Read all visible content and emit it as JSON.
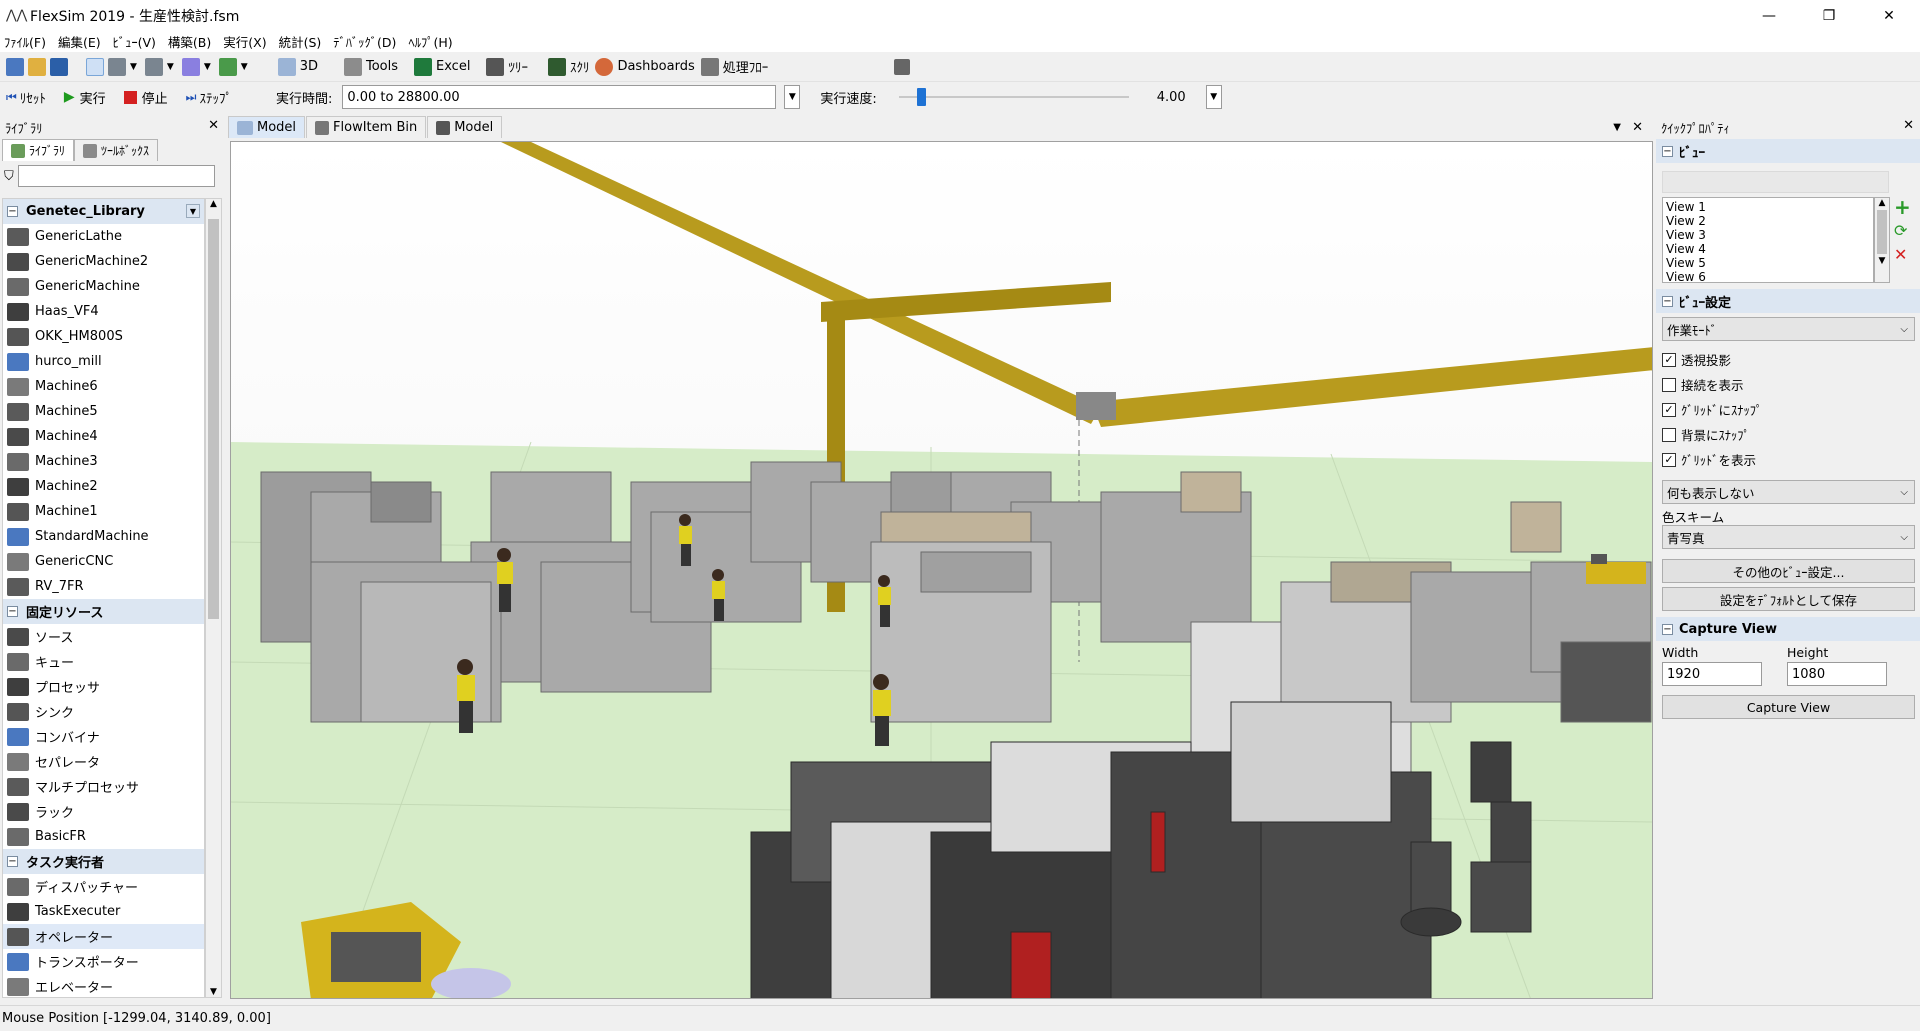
{
  "window": {
    "title": "FlexSim 2019 - 生産性検討.fsm",
    "minimize": "—",
    "maximize": "❐",
    "close": "✕"
  },
  "menu": [
    "ﾌｧｲﾙ(F)",
    "編集(E)",
    "ﾋﾞｭｰ(V)",
    "構築(B)",
    "実行(X)",
    "統計(S)",
    "ﾃﾞﾊﾞｯｸﾞ(D)",
    "ﾍﾙﾌﾟ(H)"
  ],
  "toolbar": {
    "btn_3d": "3D",
    "btn_tools": "Tools",
    "btn_excel": "Excel",
    "btn_tree": "ﾂﾘｰ",
    "btn_script": "ｽｸﾘ",
    "btn_dashboards": "Dashboards",
    "btn_processflow": "処理ﾌﾛｰ"
  },
  "runbar": {
    "reset": "ﾘｾｯﾄ",
    "run": "実行",
    "stop": "停止",
    "step": "ｽﾃｯﾌﾟ",
    "runtime_label": "実行時間:",
    "runtime_value": "0.00  to  28800.00",
    "speed_label": "実行速度:",
    "speed_value": "4.00",
    "speed_fraction": 0.08
  },
  "library": {
    "panel_title": "ﾗｲﾌﾞﾗﾘ",
    "tab_library": "ﾗｲﾌﾞﾗﾘ",
    "tab_toolbox": "ﾂｰﾙﾎﾞｯｸｽ",
    "groups": [
      {
        "name": "Genetec_Library",
        "items": [
          "GenericLathe",
          "GenericMachine2",
          "GenericMachine",
          "Haas_VF4",
          "OKK_HM800S",
          "hurco_mill",
          "Machine6",
          "Machine5",
          "Machine4",
          "Machine3",
          "Machine2",
          "Machine1",
          "StandardMachine",
          "GenericCNC",
          "RV_7FR"
        ]
      },
      {
        "name": "固定リソース",
        "items": [
          "ソース",
          "キュー",
          "プロセッサ",
          "シンク",
          "コンバイナ",
          "セパレータ",
          "マルチプロセッサ",
          "ラック",
          "BasicFR"
        ]
      },
      {
        "name": "タスク実行者",
        "items": [
          "ディスパッチャー",
          "TaskExecuter",
          "オペレーター",
          "トランスポーター",
          "エレベーター"
        ]
      }
    ],
    "selected_item": "オペレーター"
  },
  "view_tabs": [
    "Model",
    "FlowItem Bin",
    "Model"
  ],
  "quick_props": {
    "panel_title": "ｸｲｯｸﾌﾟﾛﾊﾟﾃｨ",
    "sec_view": "ﾋﾞｭｰ",
    "views": [
      "View 1",
      "View 2",
      "View 3",
      "View 4",
      "View 5",
      "View 6"
    ],
    "sec_view_settings": "ﾋﾞｭｰ設定",
    "mode": "作業ﾓｰﾄﾞ",
    "checks": [
      {
        "label": "透視投影",
        "checked": true
      },
      {
        "label": "接続を表示",
        "checked": false
      },
      {
        "label": "ｸﾞﾘｯﾄﾞにｽﾅｯﾌﾟ",
        "checked": true
      },
      {
        "label": "背景にｽﾅｯﾌﾟ",
        "checked": false
      },
      {
        "label": "ｸﾞﾘｯﾄﾞを表示",
        "checked": true
      }
    ],
    "display": "何も表示しない",
    "color_scheme_label": "色スキーム",
    "color_scheme": "青写真",
    "btn_more": "その他のﾋﾞｭｰ設定...",
    "btn_save_default": "設定をﾃﾞﾌｫﾙﾄとして保存",
    "sec_capture": "Capture View",
    "width_label": "Width",
    "width_value": "1920",
    "height_label": "Height",
    "height_value": "1080",
    "btn_capture": "Capture View"
  },
  "status": {
    "mouse_position": "Mouse Position [-1299.04, 3140.89, 0.00]"
  },
  "colors": {
    "accent": "#1e72d4",
    "group_header": "#dce6f2",
    "floor": "#d6ecc8",
    "crane": "#b89b1e",
    "machine": "#a9a9a9"
  }
}
